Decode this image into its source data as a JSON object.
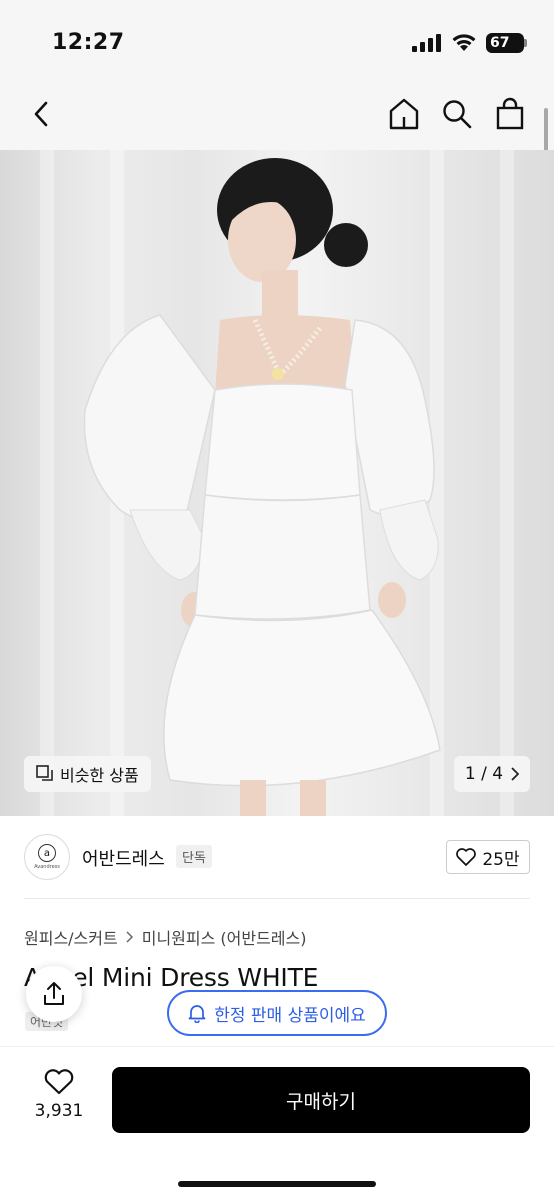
{
  "status_bar": {
    "time": "12:27",
    "battery": "67"
  },
  "nav": {
    "back_icon": "chevron-left-icon",
    "home_icon": "home-icon",
    "search_icon": "search-icon",
    "bag_icon": "shopping-bag-icon"
  },
  "hero": {
    "similar_label": "비슷한 상품",
    "page_indicator": "1 / 4"
  },
  "brand": {
    "logo_letter": "a",
    "logo_sub": "Avandress",
    "name": "어반드레스",
    "badge": "단독",
    "likes": "25만"
  },
  "breadcrumb": {
    "category": "원피스/스커트",
    "subcategory": "미니원피스 (어반드레스)"
  },
  "product": {
    "title": "Angel Mini Dress WHITE",
    "tag": "어반핏"
  },
  "limited_notice": "한정 판매 상품이에요",
  "bottom": {
    "like_count": "3,931",
    "buy_label": "구매하기"
  },
  "colors": {
    "accent": "#2c5fe3",
    "buy_bg": "#000000"
  }
}
